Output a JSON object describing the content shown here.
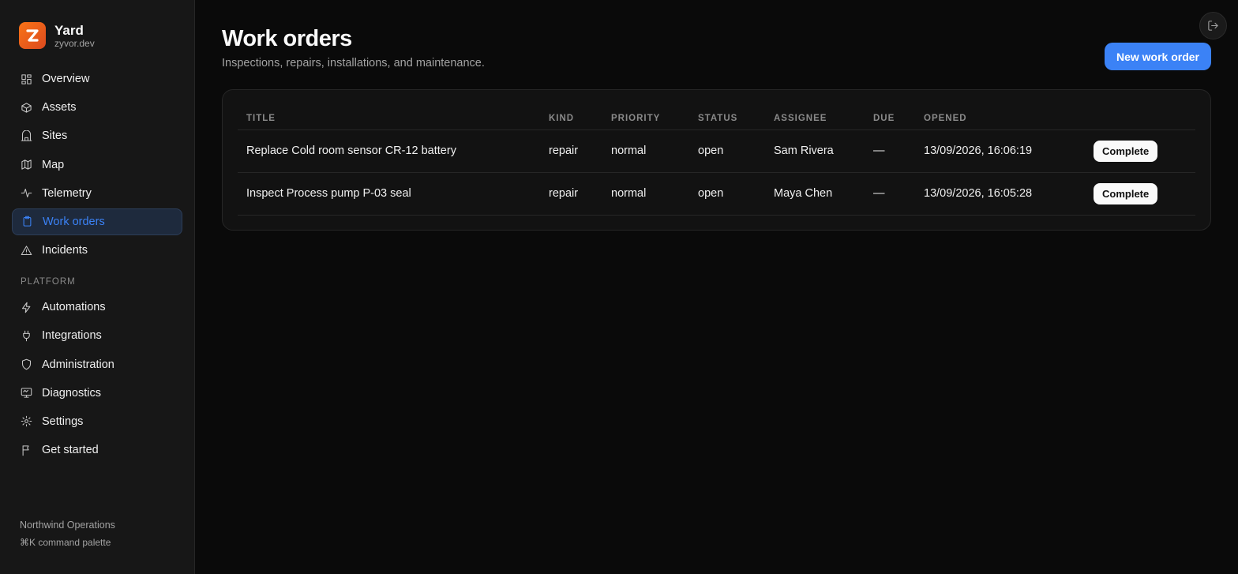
{
  "brand": {
    "name": "Yard",
    "domain": "zyvor.dev",
    "logo_letter": "Z",
    "logo_color": "#f97316"
  },
  "nav": {
    "main": [
      {
        "label": "Overview",
        "icon": "layout-dashboard-icon"
      },
      {
        "label": "Assets",
        "icon": "box-icon"
      },
      {
        "label": "Sites",
        "icon": "building-icon"
      },
      {
        "label": "Map",
        "icon": "map-icon"
      },
      {
        "label": "Telemetry",
        "icon": "activity-icon"
      },
      {
        "label": "Work orders",
        "icon": "clipboard-icon",
        "active": true
      },
      {
        "label": "Incidents",
        "icon": "alert-triangle-icon"
      }
    ],
    "platform_label": "PLATFORM",
    "platform": [
      {
        "label": "Automations",
        "icon": "zap-icon"
      },
      {
        "label": "Integrations",
        "icon": "plug-icon"
      },
      {
        "label": "Administration",
        "icon": "shield-icon"
      },
      {
        "label": "Diagnostics",
        "icon": "monitor-icon"
      },
      {
        "label": "Settings",
        "icon": "gear-icon"
      },
      {
        "label": "Get started",
        "icon": "flag-icon"
      }
    ]
  },
  "footer": {
    "org": "Northwind Operations",
    "hint": "⌘K command palette"
  },
  "page": {
    "title": "Work orders",
    "subtitle": "Inspections, repairs, installations, and maintenance.",
    "new_button": "New work order"
  },
  "table": {
    "columns": [
      "TITLE",
      "KIND",
      "PRIORITY",
      "STATUS",
      "ASSIGNEE",
      "DUE",
      "OPENED"
    ],
    "rows": [
      {
        "title": "Replace Cold room sensor CR-12 battery",
        "kind": "repair",
        "priority": "normal",
        "status": "open",
        "assignee": "Sam Rivera",
        "due": "—",
        "opened": "13/09/2026, 16:06:19",
        "action": "Complete"
      },
      {
        "title": "Inspect Process pump P-03 seal",
        "kind": "repair",
        "priority": "normal",
        "status": "open",
        "assignee": "Maya Chen",
        "due": "—",
        "opened": "13/09/2026, 16:05:28",
        "action": "Complete"
      }
    ]
  },
  "colors": {
    "accent": "#3b82f6",
    "background": "#0a0a0a",
    "sidebar": "#171717"
  }
}
